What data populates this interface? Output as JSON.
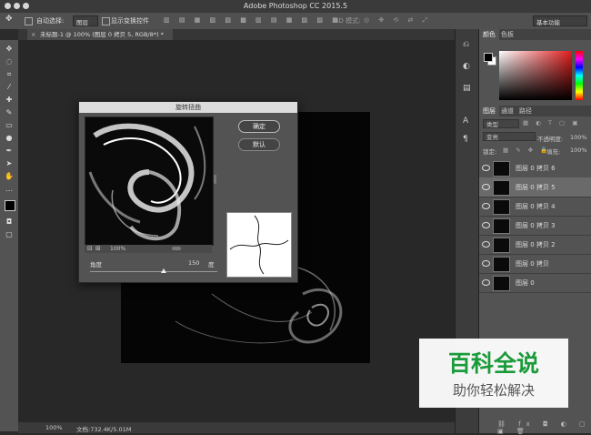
{
  "app": {
    "title": "Adobe Photoshop CC 2015.5"
  },
  "options_bar": {
    "auto_select_label": "自动选择:",
    "auto_select_value": "图层",
    "show_transform_label": "显示变换控件",
    "mode_3d_label": "3D 模式:",
    "workspace_value": "基本功能"
  },
  "document": {
    "tab_label": "未标题-1 @ 100% (图层 0 拷贝 5, RGB/8*) *",
    "status_zoom": "100%",
    "status_doc": "文档:732.4K/5.01M"
  },
  "dialog": {
    "title": "旋转扭曲",
    "ok_label": "确定",
    "default_label": "默认",
    "zoom_value": "100%",
    "angle_label": "角度",
    "angle_value": "150",
    "angle_unit": "度",
    "angle_range": [
      -999,
      999
    ]
  },
  "panels": {
    "color_tabs": [
      "颜色",
      "色板"
    ],
    "layers_tabs": [
      "图层",
      "通道",
      "路径"
    ],
    "kind_filter": "类型",
    "blend_mode": "变亮",
    "opacity_label": "不透明度:",
    "opacity_value": "100%",
    "lock_label": "锁定:",
    "fill_label": "填充:",
    "fill_value": "100%",
    "layers": [
      {
        "name": "图层 0 拷贝 6",
        "selected": false
      },
      {
        "name": "图层 0 拷贝 5",
        "selected": true
      },
      {
        "name": "图层 0 拷贝 4",
        "selected": false
      },
      {
        "name": "图层 0 拷贝 3",
        "selected": false
      },
      {
        "name": "图层 0 拷贝 2",
        "selected": false
      },
      {
        "name": "图层 0 拷贝",
        "selected": false
      },
      {
        "name": "图层 0",
        "selected": false
      }
    ]
  },
  "watermark": {
    "top": "百科全说",
    "bottom": "助你轻松解决"
  },
  "colors": {
    "accent_green": "#1a9b3a",
    "selected_row": "#6a6a6a"
  }
}
